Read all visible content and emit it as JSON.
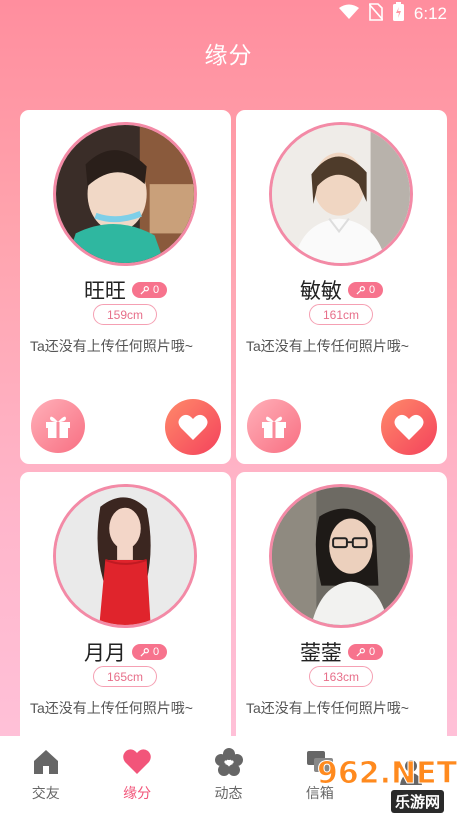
{
  "status_bar": {
    "time": "6:12",
    "icons": [
      "wifi-icon",
      "no-sim-icon",
      "battery-charging-icon"
    ]
  },
  "header": {
    "title": "缘分"
  },
  "cards": [
    {
      "name": "旺旺",
      "badge_count": "0",
      "height": "159cm",
      "description": "Ta还没有上传任何照片哦~"
    },
    {
      "name": "敏敏",
      "badge_count": "0",
      "height": "161cm",
      "description": "Ta还没有上传任何照片哦~"
    },
    {
      "name": "月月",
      "badge_count": "0",
      "height": "165cm",
      "description": "Ta还没有上传任何照片哦~"
    },
    {
      "name": "蓥蓥",
      "badge_count": "0",
      "height": "163cm",
      "description": "Ta还没有上传任何照片哦~"
    }
  ],
  "bottom_nav": {
    "items": [
      {
        "label": "交友",
        "icon": "home-icon",
        "active": false
      },
      {
        "label": "缘分",
        "icon": "heart-icon",
        "active": true
      },
      {
        "label": "动态",
        "icon": "flower-icon",
        "active": false
      },
      {
        "label": "信箱",
        "icon": "messages-icon",
        "active": false
      },
      {
        "label": "",
        "icon": "profile-icon",
        "active": false
      }
    ]
  },
  "watermark": {
    "brand": "962.NET",
    "subtitle": "乐游网"
  },
  "colors": {
    "accent": "#f2557a",
    "card_border": "#f38aa6",
    "badge": "#f7738d"
  }
}
